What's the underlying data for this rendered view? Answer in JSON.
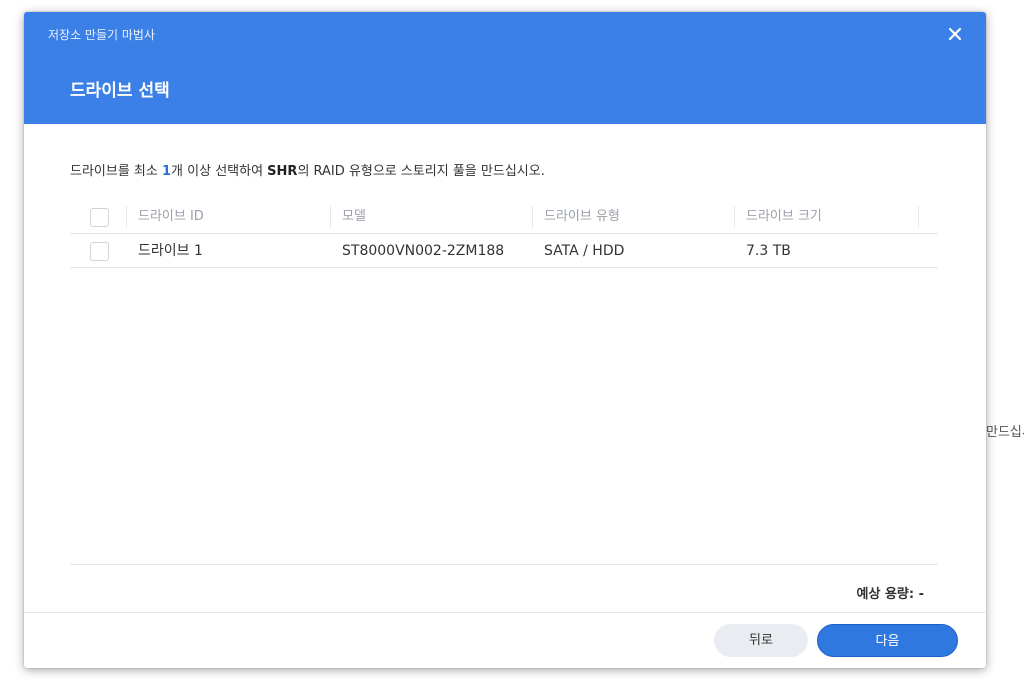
{
  "background": {
    "fragment_text": "만드십시오"
  },
  "dialog": {
    "wizard_title": "저장소 만들기 마법사",
    "step_title": "드라이브 선택",
    "close_icon": "close-icon",
    "instruction": {
      "prefix": "드라이브를 최소 ",
      "count": "1",
      "mid1": "개 이상 선택하여 ",
      "raid": "SHR",
      "suffix": "의 RAID 유형으로 스토리지 풀을 만드십시오."
    },
    "table": {
      "columns": [
        "드라이브 ID",
        "모델",
        "드라이브 유형",
        "드라이브 크기"
      ],
      "rows": [
        {
          "id": "드라이브 1",
          "model": "ST8000VN002-2ZM188",
          "type": "SATA / HDD",
          "size": "7.3 TB",
          "checked": false
        }
      ]
    },
    "capacity_label": "예상 용량: -",
    "buttons": {
      "back": "뒤로",
      "next": "다음"
    },
    "colors": {
      "header": "#3a80e6",
      "primary_button": "#2f78e0",
      "accent_text": "#2e6fd6"
    }
  }
}
